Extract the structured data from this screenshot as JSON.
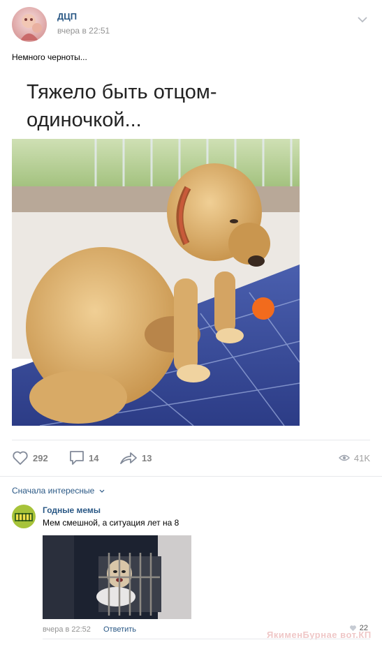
{
  "post": {
    "author": "ДЦП",
    "time": "вчера в 22:51",
    "text": "Немного черноты...",
    "meme_caption": "Тяжело быть отцом-одиночкой..."
  },
  "actions": {
    "likes": "292",
    "comments": "14",
    "shares": "13",
    "views": "41K"
  },
  "comments_section": {
    "sort_label": "Сначала интересные",
    "comment": {
      "author": "Годные мемы",
      "text": "Мем смешной, а ситуация лет на 8",
      "time": "вчера в 22:52",
      "reply_label": "Ответить",
      "likes": "22"
    }
  },
  "watermark": "ЯкименБурнае вот.КП",
  "colors": {
    "link": "#2a5885",
    "muted": "#939393",
    "divider": "#e7e8ec"
  },
  "icons": [
    "chevron-down-icon",
    "heart-icon",
    "comment-icon",
    "share-icon",
    "eye-icon"
  ]
}
